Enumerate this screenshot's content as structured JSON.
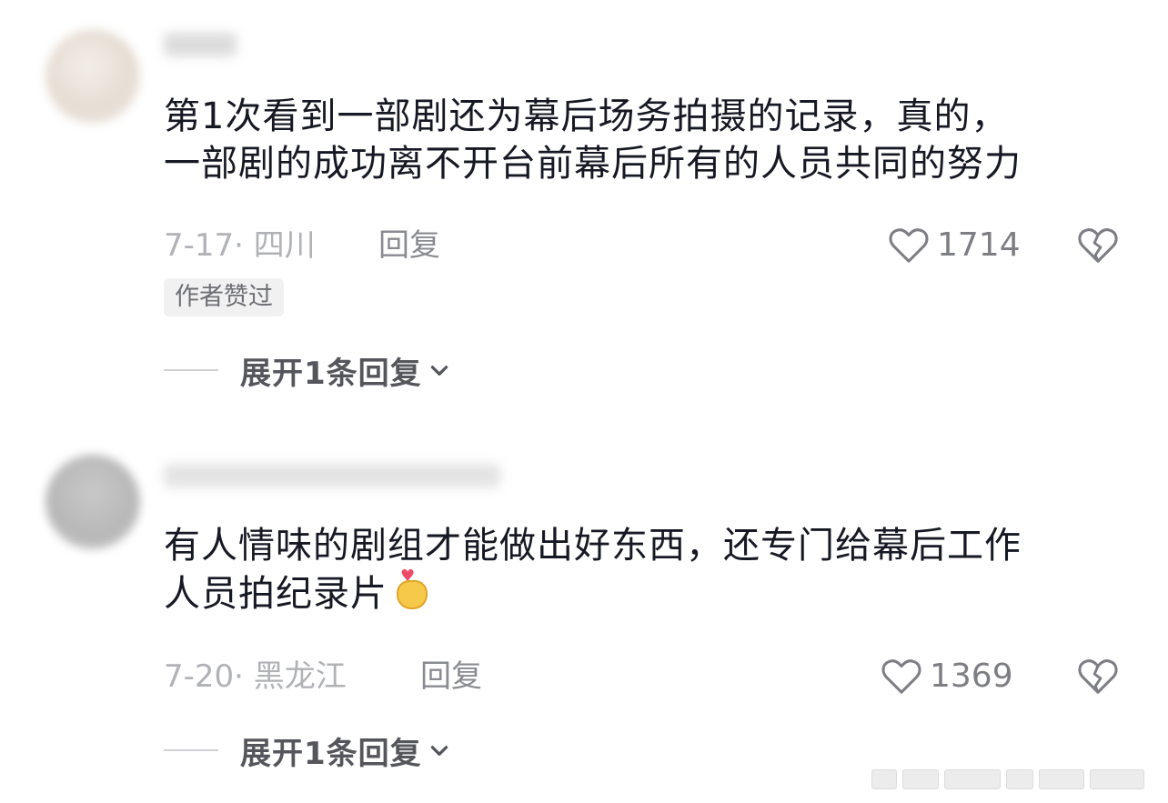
{
  "comments": [
    {
      "content_lines": [
        "第1次看到一部剧还为幕后场务拍摄的记录，真的，",
        "一部剧的成功离不开台前幕后所有的人员共同的努力"
      ],
      "date_location": "7-17· 四川",
      "reply_label": "回复",
      "like_count": "1714",
      "author_liked_badge": "作者赞过",
      "expand_label": "展开1条回复"
    },
    {
      "content_lines": [
        "有人情味的剧组才能做出好东西，还专门给幕后工作",
        "人员拍纪录片"
      ],
      "emoji": "finger-heart-emoji",
      "date_location": "7-20· 黑龙江",
      "reply_label": "回复",
      "like_count": "1369",
      "expand_label": "展开1条回复"
    }
  ],
  "icons": {
    "like": "heart-outline-icon",
    "dislike": "broken-heart-icon",
    "expand": "chevron-down-icon"
  },
  "colors": {
    "text_primary": "#161823",
    "text_meta": "#b0b2b6",
    "icon_gray": "#7d7e84",
    "badge_bg": "#f1f1f2"
  }
}
